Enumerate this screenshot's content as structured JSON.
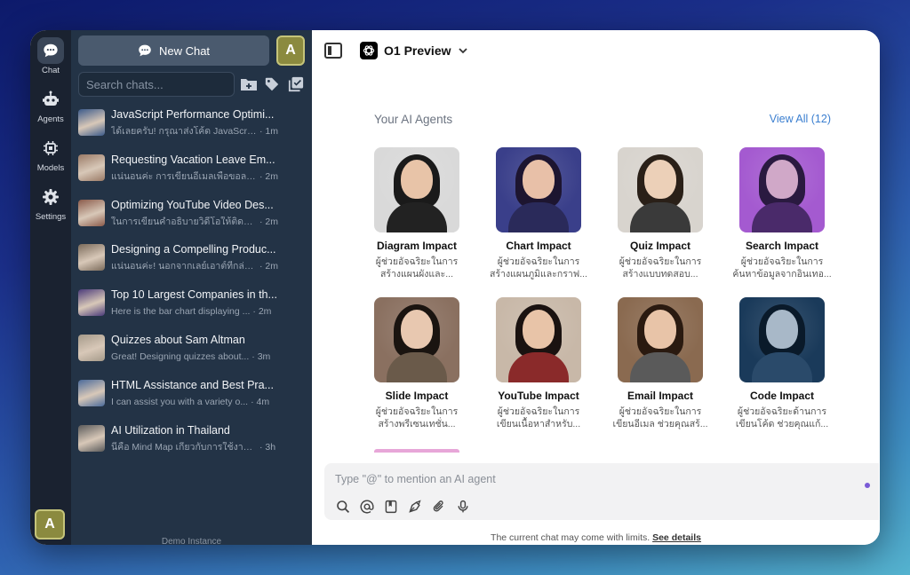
{
  "rail": {
    "items": [
      {
        "label": "Chat",
        "icon": "chat-bubble-icon",
        "active": true
      },
      {
        "label": "Agents",
        "icon": "robot-icon",
        "active": false
      },
      {
        "label": "Models",
        "icon": "chip-icon",
        "active": false
      },
      {
        "label": "Settings",
        "icon": "gear-icon",
        "active": false
      }
    ],
    "avatar": "A"
  },
  "sidebar": {
    "new_chat_label": "New Chat",
    "avatar": "A",
    "search_placeholder": "Search chats...",
    "chats": [
      {
        "title": "JavaScript Performance Optimi...",
        "preview": "ได้เลยครับ! กรุณาส่งโค้ด JavaScrip...",
        "time": "1m",
        "thumb": "#3b5a8a"
      },
      {
        "title": "Requesting Vacation Leave Em...",
        "preview": "แน่นอนค่ะ การเขียนอีเมลเพื่อขอลาพั...",
        "time": "2m",
        "thumb": "#9a7a66"
      },
      {
        "title": "Optimizing YouTube Video Des...",
        "preview": "ในการเขียนคำอธิบายวิดีโอให้ติดอัน...",
        "time": "2m",
        "thumb": "#8a5a4a"
      },
      {
        "title": "Designing a Compelling Produc...",
        "preview": "แน่นอนค่ะ! นอกจากเลย์เอาต์ที่กล่าวไ...",
        "time": "2m",
        "thumb": "#7a6a5a"
      },
      {
        "title": "Top 10 Largest Companies in th...",
        "preview": "Here is the bar chart displaying ...",
        "time": "2m",
        "thumb": "#4a3a7a"
      },
      {
        "title": "Quizzes about Sam Altman",
        "preview": "Great! Designing quizzes about...",
        "time": "3m",
        "thumb": "#a59a8a"
      },
      {
        "title": "HTML Assistance and Best Pra...",
        "preview": "I can assist you with a variety o...",
        "time": "4m",
        "thumb": "#4a6a9a"
      },
      {
        "title": "AI Utilization in Thailand",
        "preview": "นี่คือ Mind Map เกี่ยวกับการใช้งาน ...",
        "time": "3h",
        "thumb": "#5a5a5a"
      }
    ],
    "footer": "Demo Instance"
  },
  "main": {
    "model_name": "O1 Preview",
    "agents_title": "Your AI Agents",
    "view_all": "View All (12)",
    "agents": [
      {
        "name": "Diagram Impact",
        "desc1": "ผู้ช่วยอัจฉริยะในการ",
        "desc2": "สร้างแผนผังและ...",
        "bg": "#d9d9d9",
        "hair": "#1a1a1a",
        "skin": "#e8c4a8",
        "body": "#222222"
      },
      {
        "name": "Chart Impact",
        "desc1": "ผู้ช่วยอัจฉริยะในการ",
        "desc2": "สร้างแผนภูมิและกราฟ...",
        "bg": "#3a3f8a",
        "hair": "#1d1530",
        "skin": "#e8c0a8",
        "body": "#2a2a5a"
      },
      {
        "name": "Quiz Impact",
        "desc1": "ผู้ช่วยอัจฉริยะในการ",
        "desc2": "สร้างแบบทดสอบ...",
        "bg": "#d8d4ce",
        "hair": "#2a2018",
        "skin": "#ecd0b8",
        "body": "#3a3a3a"
      },
      {
        "name": "Search Impact",
        "desc1": "ผู้ช่วยอัจฉริยะในการ",
        "desc2": "ค้นหาข้อมูลจากอินเทอ...",
        "bg": "#a45ad0",
        "hair": "#2a1a40",
        "skin": "#d0a8c8",
        "body": "#4a2a6a"
      },
      {
        "name": "Slide Impact",
        "desc1": "ผู้ช่วยอัจฉริยะในการ",
        "desc2": "สร้างพรีเซนเทชั่น...",
        "bg": "#8a7060",
        "hair": "#1a1410",
        "skin": "#e8c8b0",
        "body": "#6a5a4a"
      },
      {
        "name": "YouTube Impact",
        "desc1": "ผู้ช่วยอัจฉริยะในการ",
        "desc2": "เขียนเนื้อหาสำหรับ...",
        "bg": "#c8b8a8",
        "hair": "#1a1210",
        "skin": "#e8c4a8",
        "body": "#8a2a2a"
      },
      {
        "name": "Email Impact",
        "desc1": "ผู้ช่วยอัจฉริยะในการ",
        "desc2": "เขียนอีเมล ช่วยคุณสร้...",
        "bg": "#8a6a50",
        "hair": "#2a1a10",
        "skin": "#e8c4a8",
        "body": "#5a5a5a"
      },
      {
        "name": "Code Impact",
        "desc1": "ผู้ช่วยอัจฉริยะด้านการ",
        "desc2": "เขียนโค้ด ช่วยคุณแก้...",
        "bg": "#1a3a5a",
        "hair": "#0a1a2a",
        "skin": "#a8b8c8",
        "body": "#2a4a6a"
      }
    ],
    "composer_placeholder": "Type \"@\" to mention an AI agent",
    "limits_text": "The current chat may come with limits.",
    "limits_link": "See details"
  }
}
